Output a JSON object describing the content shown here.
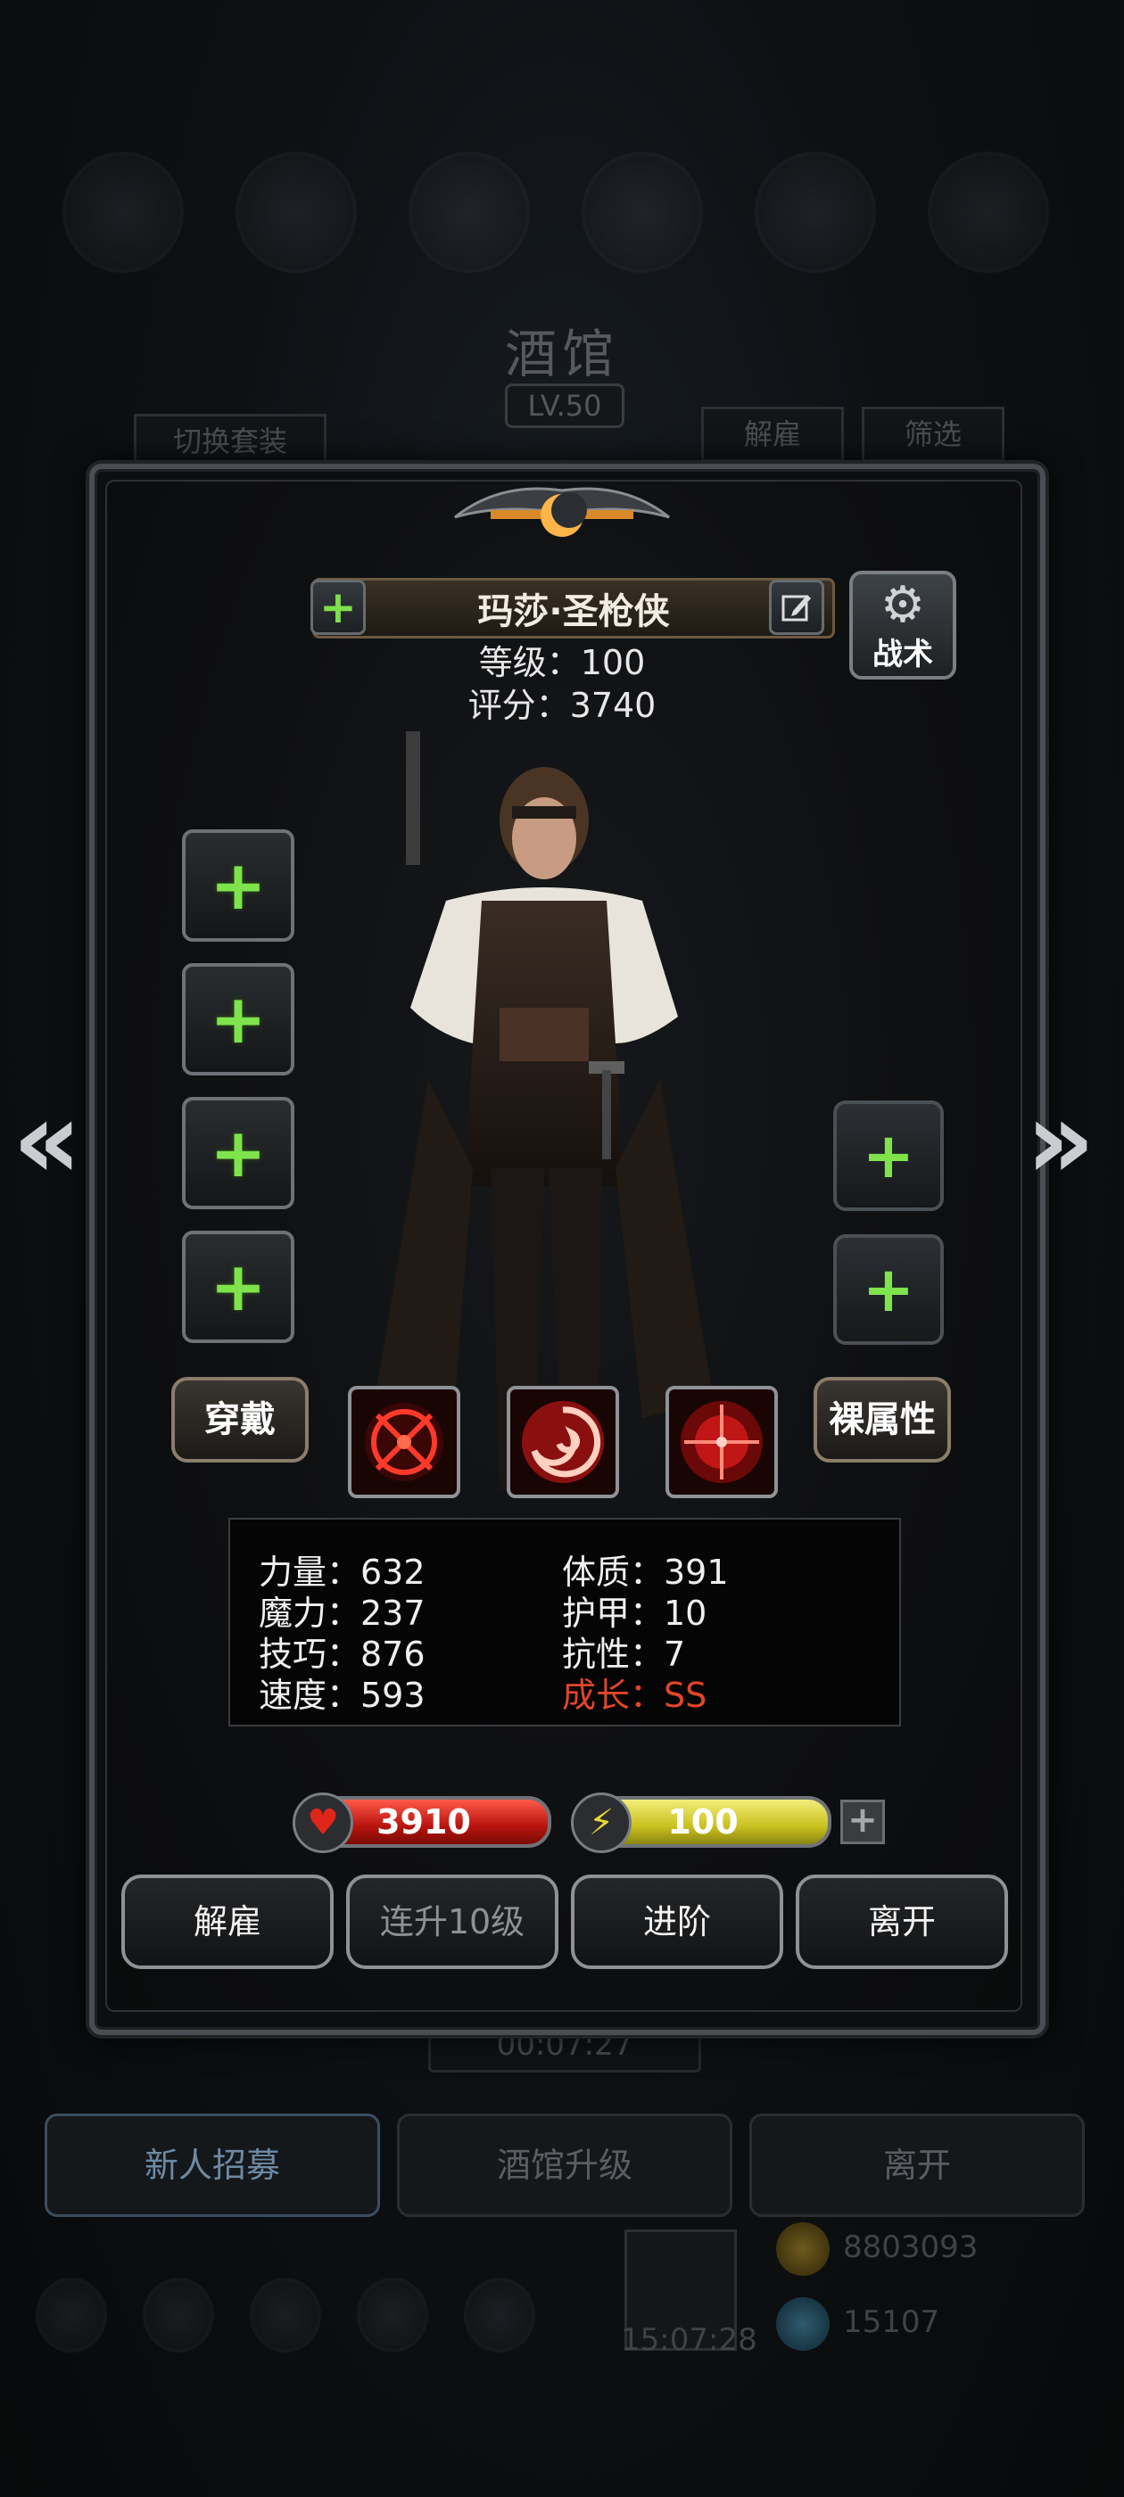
{
  "background": {
    "title": "酒馆",
    "level": "LV.50",
    "switch_outfit": "切换套装",
    "dismiss": "解雇",
    "filter": "筛选",
    "timer": "00:07:27",
    "bottom_tabs": [
      "新人招募",
      "酒馆升级",
      "离开"
    ],
    "gold": "8803093",
    "gems": "15107",
    "clock": "15:07:28"
  },
  "hero": {
    "name": "玛莎·圣枪侠",
    "level_text": "等级：100",
    "score_text": "评分：3740",
    "tactics_label": "战术"
  },
  "buttons": {
    "wear": "穿戴",
    "base_attr": "裸属性"
  },
  "attributes": {
    "strength": "力量：632",
    "magic": "魔力：237",
    "skill": "技巧：876",
    "speed": "速度：593",
    "constitution": "体质：391",
    "armor": "护甲：10",
    "resistance": "抗性：7",
    "growth": "成长：SS"
  },
  "bars": {
    "hp": "3910",
    "energy": "100"
  },
  "actions": [
    "解雇",
    "连升10级",
    "进阶",
    "离开"
  ],
  "colors": {
    "accent_green": "#7ee04b",
    "growth_red": "#e2452a",
    "hp_red": "#c8231b",
    "energy_yellow": "#d8cf2a"
  }
}
